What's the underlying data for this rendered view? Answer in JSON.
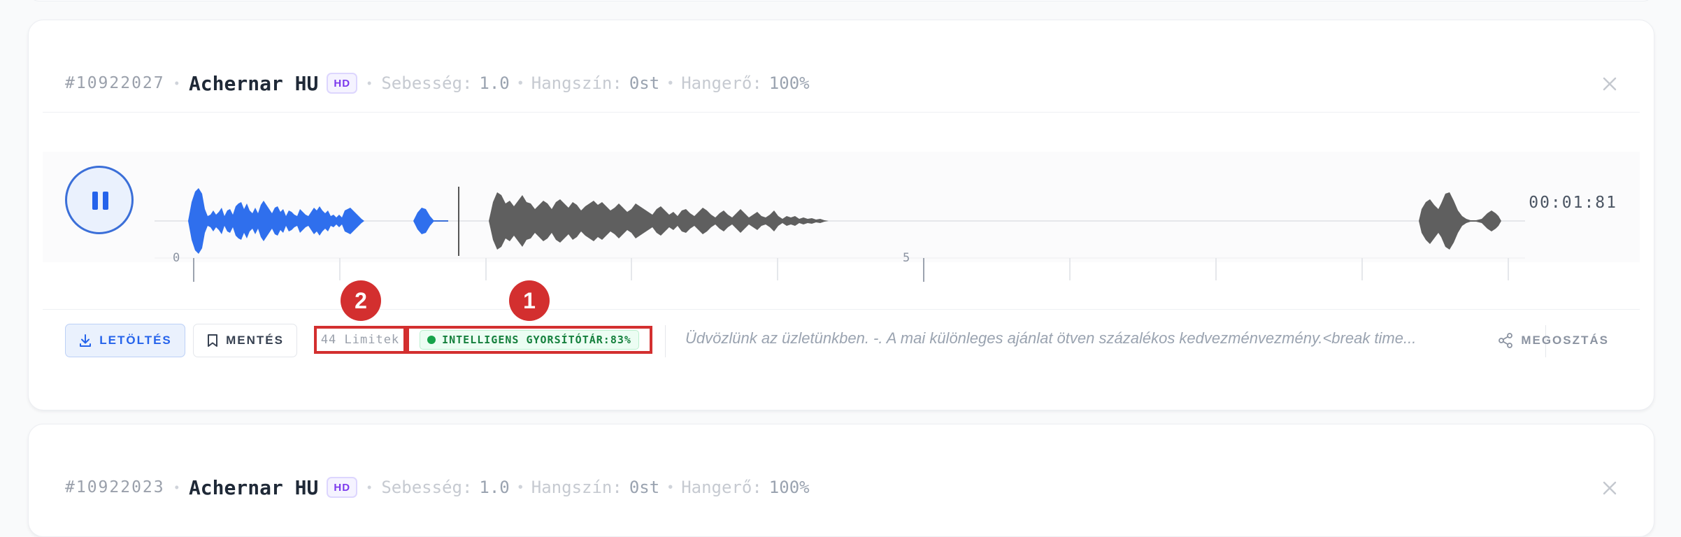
{
  "cards": [
    {
      "id": "#10922027",
      "voice": "Achernar HU",
      "quality_badge": "HD",
      "speed_label": "Sebesség:",
      "speed_value": "1.0",
      "pitch_label": "Hangszín:",
      "pitch_value": "0st",
      "volume_label": "Hangerő:",
      "volume_value": "100%",
      "player": {
        "state": "playing",
        "time": "00:01:81",
        "timeline_labels": [
          "0",
          "5"
        ]
      },
      "actions": {
        "download_label": "LETÖLTÉS",
        "save_label": "MENTÉS",
        "limit_text": "44 Limitek",
        "cache_text": "INTELLIGENS GYORSÍTÓTÁR:83%",
        "text_preview": "Üdvözlünk az üzletünkben. -. A mai különleges ajánlat ötven százalékos kedvezménvezmény.<break time...",
        "share_label": "MEGOSZTÁS"
      }
    },
    {
      "id": "#10922023",
      "voice": "Achernar HU",
      "quality_badge": "HD",
      "speed_label": "Sebesség:",
      "speed_value": "1.0",
      "pitch_label": "Hangszín:",
      "pitch_value": "0st",
      "volume_label": "Hangerő:",
      "volume_value": "100%"
    }
  ],
  "annotations": [
    "1",
    "2"
  ],
  "colors": {
    "accent": "#2563eb",
    "played_wave": "#2f6fed",
    "unplayed_wave": "#5f5f5f",
    "annotation": "#d32f2f",
    "cache_green": "#16a34a",
    "hd_purple": "#7c3aed"
  }
}
